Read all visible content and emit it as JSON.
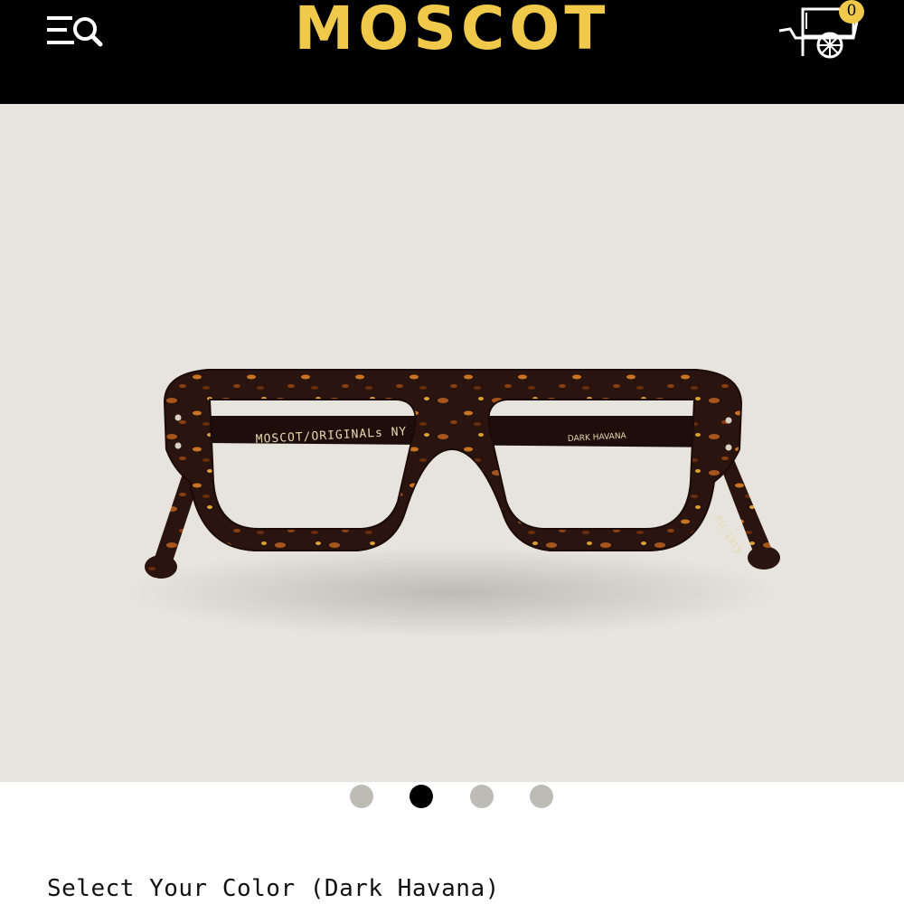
{
  "header": {
    "menu_icon": "menu-search-icon",
    "logo_text": "MOSCOT",
    "cart_icon": "pushcart-icon",
    "cart_count": "0"
  },
  "product": {
    "temple_left_text": "MOSCOT/ORIGINALs NY",
    "temple_right_text": "DARK HAVANA",
    "temple_tip_text": "Est. 1915"
  },
  "carousel": {
    "slides": [
      "slide-1",
      "slide-2",
      "slide-3",
      "slide-4"
    ],
    "active_index": 1
  },
  "color_selector": {
    "label": "Select Your Color (Dark Havana)"
  },
  "colors": {
    "header_bg": "#000000",
    "brand_yellow": "#f0c94a",
    "hero_bg": "#e6e4dc",
    "frame_dark": "#2a1410"
  }
}
